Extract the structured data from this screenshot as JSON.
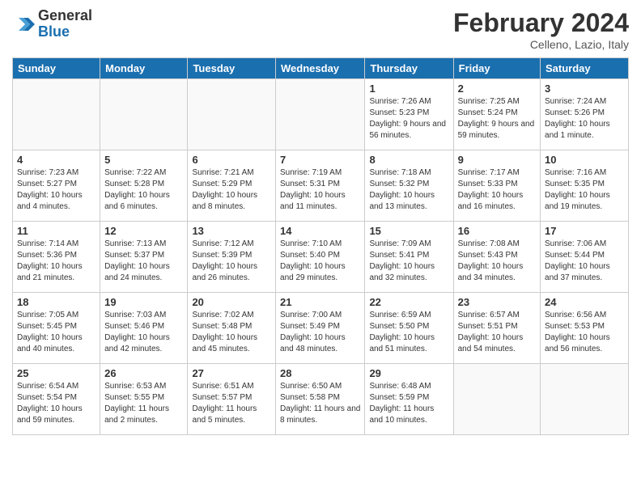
{
  "header": {
    "logo_line1": "General",
    "logo_line2": "Blue",
    "main_title": "February 2024",
    "subtitle": "Celleno, Lazio, Italy"
  },
  "days_of_week": [
    "Sunday",
    "Monday",
    "Tuesday",
    "Wednesday",
    "Thursday",
    "Friday",
    "Saturday"
  ],
  "weeks": [
    [
      {
        "day": "",
        "info": ""
      },
      {
        "day": "",
        "info": ""
      },
      {
        "day": "",
        "info": ""
      },
      {
        "day": "",
        "info": ""
      },
      {
        "day": "1",
        "info": "Sunrise: 7:26 AM\nSunset: 5:23 PM\nDaylight: 9 hours and 56 minutes."
      },
      {
        "day": "2",
        "info": "Sunrise: 7:25 AM\nSunset: 5:24 PM\nDaylight: 9 hours and 59 minutes."
      },
      {
        "day": "3",
        "info": "Sunrise: 7:24 AM\nSunset: 5:26 PM\nDaylight: 10 hours and 1 minute."
      }
    ],
    [
      {
        "day": "4",
        "info": "Sunrise: 7:23 AM\nSunset: 5:27 PM\nDaylight: 10 hours and 4 minutes."
      },
      {
        "day": "5",
        "info": "Sunrise: 7:22 AM\nSunset: 5:28 PM\nDaylight: 10 hours and 6 minutes."
      },
      {
        "day": "6",
        "info": "Sunrise: 7:21 AM\nSunset: 5:29 PM\nDaylight: 10 hours and 8 minutes."
      },
      {
        "day": "7",
        "info": "Sunrise: 7:19 AM\nSunset: 5:31 PM\nDaylight: 10 hours and 11 minutes."
      },
      {
        "day": "8",
        "info": "Sunrise: 7:18 AM\nSunset: 5:32 PM\nDaylight: 10 hours and 13 minutes."
      },
      {
        "day": "9",
        "info": "Sunrise: 7:17 AM\nSunset: 5:33 PM\nDaylight: 10 hours and 16 minutes."
      },
      {
        "day": "10",
        "info": "Sunrise: 7:16 AM\nSunset: 5:35 PM\nDaylight: 10 hours and 19 minutes."
      }
    ],
    [
      {
        "day": "11",
        "info": "Sunrise: 7:14 AM\nSunset: 5:36 PM\nDaylight: 10 hours and 21 minutes."
      },
      {
        "day": "12",
        "info": "Sunrise: 7:13 AM\nSunset: 5:37 PM\nDaylight: 10 hours and 24 minutes."
      },
      {
        "day": "13",
        "info": "Sunrise: 7:12 AM\nSunset: 5:39 PM\nDaylight: 10 hours and 26 minutes."
      },
      {
        "day": "14",
        "info": "Sunrise: 7:10 AM\nSunset: 5:40 PM\nDaylight: 10 hours and 29 minutes."
      },
      {
        "day": "15",
        "info": "Sunrise: 7:09 AM\nSunset: 5:41 PM\nDaylight: 10 hours and 32 minutes."
      },
      {
        "day": "16",
        "info": "Sunrise: 7:08 AM\nSunset: 5:43 PM\nDaylight: 10 hours and 34 minutes."
      },
      {
        "day": "17",
        "info": "Sunrise: 7:06 AM\nSunset: 5:44 PM\nDaylight: 10 hours and 37 minutes."
      }
    ],
    [
      {
        "day": "18",
        "info": "Sunrise: 7:05 AM\nSunset: 5:45 PM\nDaylight: 10 hours and 40 minutes."
      },
      {
        "day": "19",
        "info": "Sunrise: 7:03 AM\nSunset: 5:46 PM\nDaylight: 10 hours and 42 minutes."
      },
      {
        "day": "20",
        "info": "Sunrise: 7:02 AM\nSunset: 5:48 PM\nDaylight: 10 hours and 45 minutes."
      },
      {
        "day": "21",
        "info": "Sunrise: 7:00 AM\nSunset: 5:49 PM\nDaylight: 10 hours and 48 minutes."
      },
      {
        "day": "22",
        "info": "Sunrise: 6:59 AM\nSunset: 5:50 PM\nDaylight: 10 hours and 51 minutes."
      },
      {
        "day": "23",
        "info": "Sunrise: 6:57 AM\nSunset: 5:51 PM\nDaylight: 10 hours and 54 minutes."
      },
      {
        "day": "24",
        "info": "Sunrise: 6:56 AM\nSunset: 5:53 PM\nDaylight: 10 hours and 56 minutes."
      }
    ],
    [
      {
        "day": "25",
        "info": "Sunrise: 6:54 AM\nSunset: 5:54 PM\nDaylight: 10 hours and 59 minutes."
      },
      {
        "day": "26",
        "info": "Sunrise: 6:53 AM\nSunset: 5:55 PM\nDaylight: 11 hours and 2 minutes."
      },
      {
        "day": "27",
        "info": "Sunrise: 6:51 AM\nSunset: 5:57 PM\nDaylight: 11 hours and 5 minutes."
      },
      {
        "day": "28",
        "info": "Sunrise: 6:50 AM\nSunset: 5:58 PM\nDaylight: 11 hours and 8 minutes."
      },
      {
        "day": "29",
        "info": "Sunrise: 6:48 AM\nSunset: 5:59 PM\nDaylight: 11 hours and 10 minutes."
      },
      {
        "day": "",
        "info": ""
      },
      {
        "day": "",
        "info": ""
      }
    ]
  ]
}
